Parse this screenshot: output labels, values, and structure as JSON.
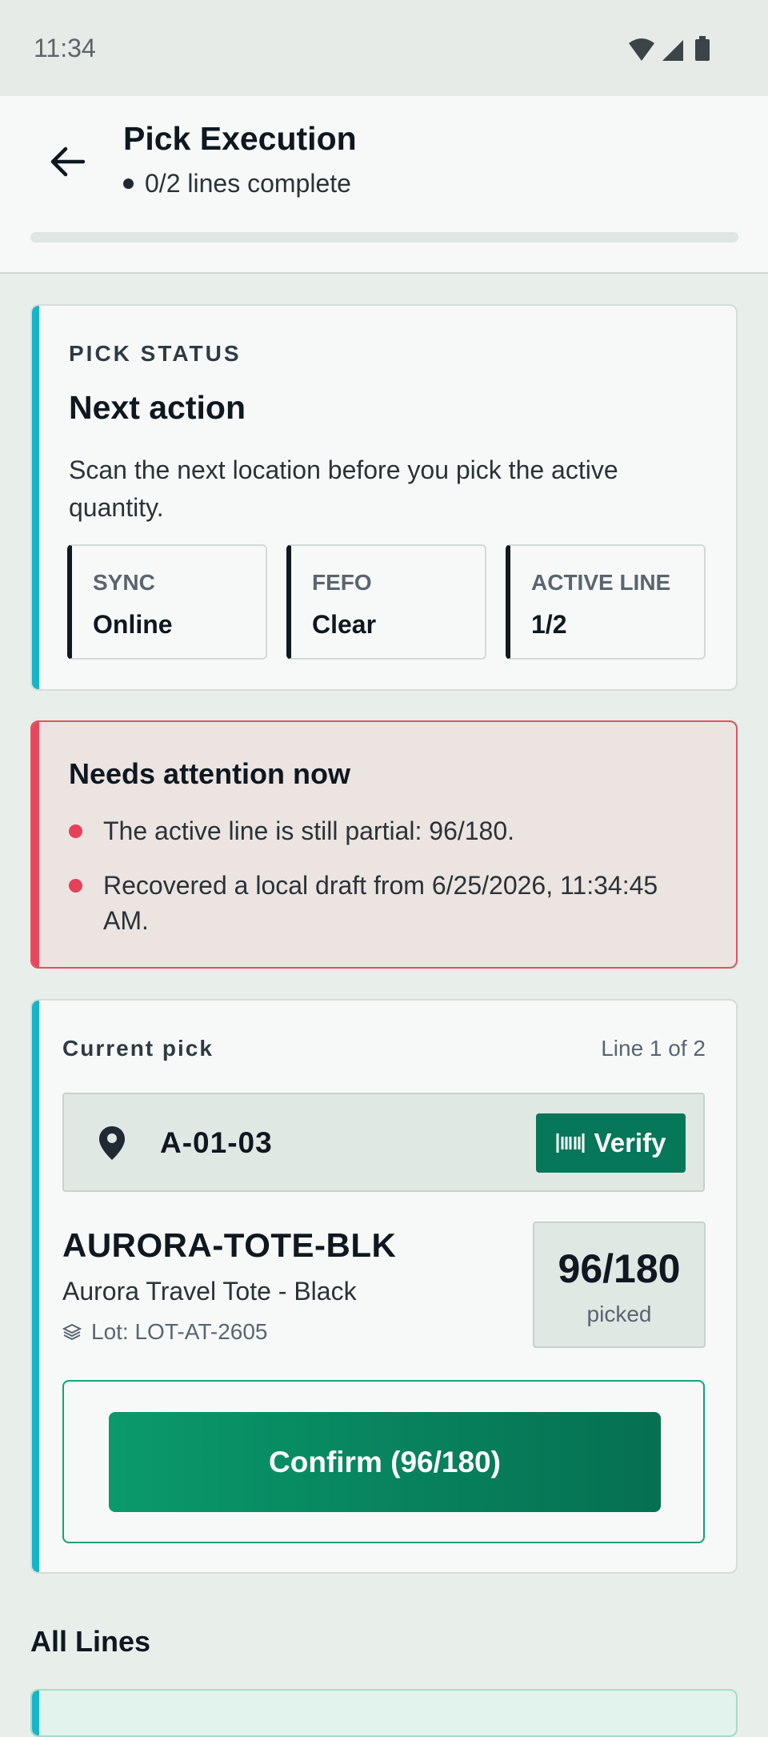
{
  "status_bar": {
    "time": "11:34"
  },
  "app_bar": {
    "title": "Pick Execution",
    "subtitle": "0/2 lines complete",
    "progress_fraction": 0
  },
  "pick_status": {
    "eyebrow": "PICK STATUS",
    "heading": "Next action",
    "description": "Scan the next location before you pick the active quantity.",
    "chips": [
      {
        "label": "SYNC",
        "value": "Online"
      },
      {
        "label": "FEFO",
        "value": "Clear"
      },
      {
        "label": "ACTIVE LINE",
        "value": "1/2"
      }
    ]
  },
  "attention": {
    "heading": "Needs attention now",
    "items": [
      "The active line is still partial: 96/180.",
      "Recovered a local draft from 6/25/2026, 11:34:45 AM."
    ]
  },
  "current_pick": {
    "label": "Current pick",
    "line_indicator": "Line 1 of 2",
    "location": "A-01-03",
    "verify_label": "Verify",
    "sku": "AURORA-TOTE-BLK",
    "product_name": "Aurora Travel Tote - Black",
    "lot": "Lot: LOT-AT-2605",
    "quantity": "96/180",
    "quantity_caption": "picked",
    "confirm_label": "Confirm (96/180)"
  },
  "all_lines": {
    "title": "All Lines"
  },
  "colors": {
    "accent_teal": "#15b5cc",
    "alert_red": "#e8465a",
    "primary_green": "#07775a",
    "background": "#e8eeea"
  },
  "icons": [
    "back-arrow-icon",
    "wifi-icon",
    "signal-icon",
    "battery-icon",
    "location-pin-icon",
    "barcode-icon",
    "layers-icon"
  ]
}
